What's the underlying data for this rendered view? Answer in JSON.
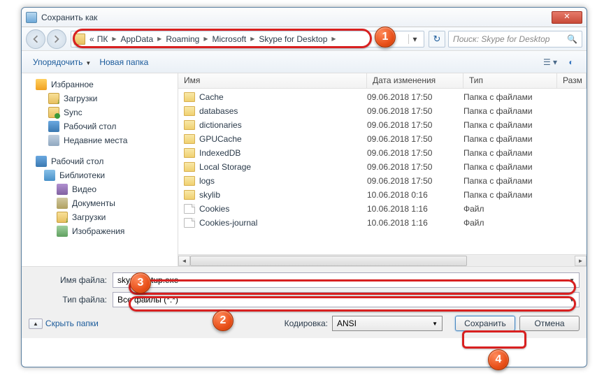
{
  "title": "Сохранить как",
  "breadcrumbs": [
    "ПК",
    "AppData",
    "Roaming",
    "Microsoft",
    "Skype for Desktop"
  ],
  "search_ph": "Поиск: Skype for Desktop",
  "toolbar": {
    "organize": "Упорядочить",
    "newfolder": "Новая папка"
  },
  "sidebar": {
    "fav": "Избранное",
    "fav_items": [
      "Загрузки",
      "Sync",
      "Рабочий стол",
      "Недавние места"
    ],
    "desk": "Рабочий стол",
    "lib": "Библиотеки",
    "lib_items": [
      "Видео",
      "Документы",
      "Загрузки",
      "Изображения"
    ]
  },
  "columns": {
    "name": "Имя",
    "date": "Дата изменения",
    "type": "Тип",
    "size": "Разм"
  },
  "files": [
    {
      "n": "Cache",
      "d": "09.06.2018 17:50",
      "t": "Папка с файлами",
      "f": true
    },
    {
      "n": "databases",
      "d": "09.06.2018 17:50",
      "t": "Папка с файлами",
      "f": true
    },
    {
      "n": "dictionaries",
      "d": "09.06.2018 17:50",
      "t": "Папка с файлами",
      "f": true
    },
    {
      "n": "GPUCache",
      "d": "09.06.2018 17:50",
      "t": "Папка с файлами",
      "f": true
    },
    {
      "n": "IndexedDB",
      "d": "09.06.2018 17:50",
      "t": "Папка с файлами",
      "f": true
    },
    {
      "n": "Local Storage",
      "d": "09.06.2018 17:50",
      "t": "Папка с файлами",
      "f": true
    },
    {
      "n": "logs",
      "d": "09.06.2018 17:50",
      "t": "Папка с файлами",
      "f": true
    },
    {
      "n": "skylib",
      "d": "10.06.2018 0:16",
      "t": "Папка с файлами",
      "f": true
    },
    {
      "n": "Cookies",
      "d": "10.06.2018 1:16",
      "t": "Файл",
      "f": false
    },
    {
      "n": "Cookies-journal",
      "d": "10.06.2018 1:16",
      "t": "Файл",
      "f": false
    }
  ],
  "filename_lbl": "Имя файла:",
  "filename_val": "skype-setup.exe",
  "filetype_lbl": "Тип файла:",
  "filetype_val": "Все файлы  (*.*)",
  "hide_folders": "Скрыть папки",
  "encoding_lbl": "Кодировка:",
  "encoding_val": "ANSI",
  "save_btn": "Сохранить",
  "cancel_btn": "Отмена",
  "badges": {
    "1": "1",
    "2": "2",
    "3": "3",
    "4": "4"
  }
}
